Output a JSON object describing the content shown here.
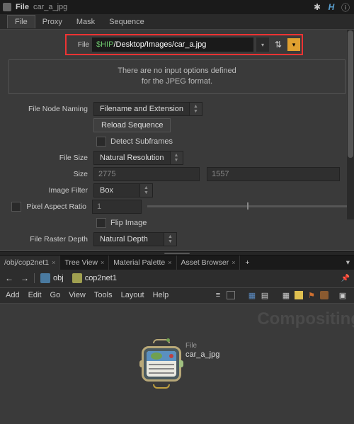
{
  "title_bar": {
    "node_type": "File",
    "node_name": "car_a_jpg"
  },
  "title_icons": {
    "gear": "✱",
    "h": "H",
    "info": "ⓘ"
  },
  "main_tabs": [
    "File",
    "Proxy",
    "Mask",
    "Sequence"
  ],
  "file": {
    "label": "File",
    "hip": "$HIP",
    "path": "/Desktop/Images/car_a.jpg"
  },
  "info_box": {
    "line1": "There are no input options defined",
    "line2": "for the JPEG format."
  },
  "params": {
    "file_node_naming": {
      "label": "File Node Naming",
      "value": "Filename and Extension"
    },
    "reload": "Reload Sequence",
    "detect_subframes": "Detect Subframes",
    "file_size": {
      "label": "File Size",
      "value": "Natural Resolution"
    },
    "size": {
      "label": "Size",
      "w": "2775",
      "h": "1557"
    },
    "image_filter": {
      "label": "Image Filter",
      "value": "Box"
    },
    "pixel_aspect": {
      "label": "Pixel Aspect Ratio",
      "value": "1"
    },
    "flip_image": "Flip Image",
    "file_raster_depth": {
      "label": "File Raster Depth",
      "value": "Natural Depth"
    }
  },
  "panel_tabs": [
    "/obj/cop2net1",
    "Tree View",
    "Material Palette",
    "Asset Browser"
  ],
  "path_bar": {
    "seg1": "obj",
    "seg2": "cop2net1"
  },
  "menu": [
    "Add",
    "Edit",
    "Go",
    "View",
    "Tools",
    "Layout",
    "Help"
  ],
  "watermark": "Compositing",
  "node": {
    "type": "File",
    "name": "car_a_jpg"
  },
  "glyphs": {
    "plus": "+",
    "x": "×",
    "down": "▾",
    "left": "←",
    "right": "→",
    "updown": "⇅",
    "pin": "📌"
  }
}
